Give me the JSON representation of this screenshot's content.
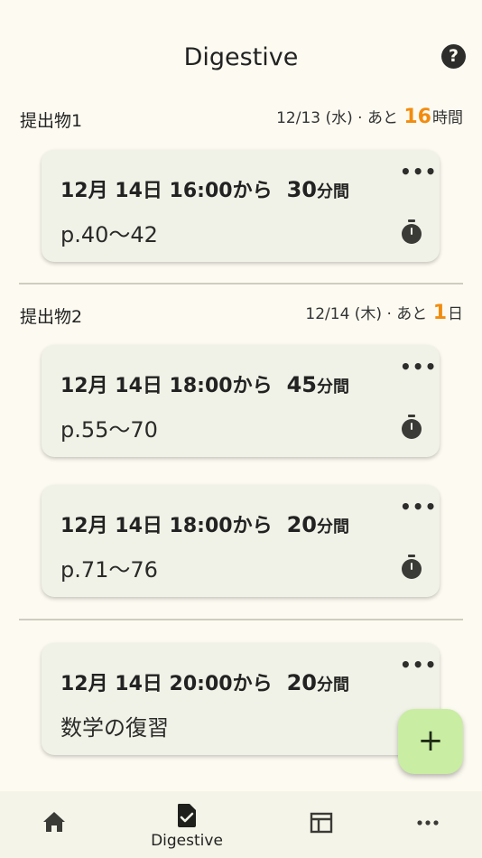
{
  "header": {
    "title": "Digestive",
    "help_icon": "question-circle-icon"
  },
  "sections": [
    {
      "name": "提出物1",
      "due_date": "12/13 (水) · あと",
      "due_num": "16",
      "due_unit": "時間"
    },
    {
      "name": "提出物2",
      "due_date": "12/14 (木) · あと",
      "due_num": "1",
      "due_unit": "日"
    }
  ],
  "cards": [
    {
      "when": "12月 14日  16:00から",
      "duration": "30",
      "unit": "分間",
      "pages": "p.40～42"
    },
    {
      "when": "12月 14日  18:00から",
      "duration": "45",
      "unit": "分間",
      "pages": "p.55～70"
    },
    {
      "when": "12月 14日  18:00から",
      "duration": "20",
      "unit": "分間",
      "pages": "p.71～76"
    },
    {
      "when": "12月 14日  20:00から",
      "duration": "20",
      "unit": "分間",
      "pages": "数学の復習"
    }
  ],
  "card_menu_label": "•••",
  "fab": {
    "label": "+",
    "icon": "plus-icon"
  },
  "nav": {
    "items": [
      {
        "icon": "home-icon",
        "label": ""
      },
      {
        "icon": "assignment-check-icon",
        "label": "Digestive",
        "active": true
      },
      {
        "icon": "table-icon",
        "label": ""
      },
      {
        "icon": "more-horizontal-icon",
        "label": ""
      }
    ]
  },
  "colors": {
    "background": "#fdfbf1",
    "card": "#f1f2e7",
    "accent": "#f28c0f",
    "fab": "#c9eda3"
  }
}
